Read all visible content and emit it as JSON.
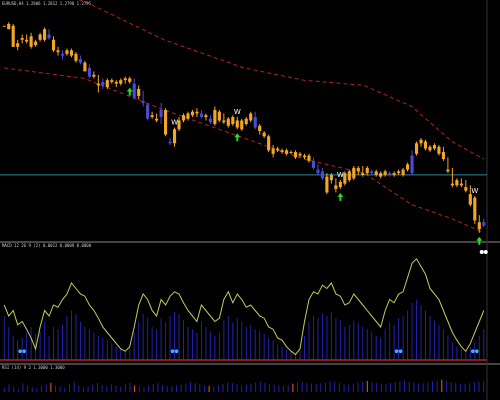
{
  "colors": {
    "background": "#000000",
    "bullish": "#f5a623",
    "bearish": "#4b4bd6",
    "bands": "#b22222",
    "signal_line": "#c8c85a",
    "histogram": "#2222aa",
    "level_line": "#2a8a9a",
    "up_arrow": "#22dd22",
    "dot_blue": "#3ab0ff",
    "dot_white": "#ffffff",
    "panel_border": "#8a8a8a"
  },
  "panels": {
    "price_header": "EURUSD,H4 1.2806 1.2812 1.2790 1.2795",
    "osc_header": "MACD 12 26 9 (2) 0.0012 0.0009 0.0000",
    "vol_header": "RSI (14)  9 2 1.3000 1.3000"
  },
  "chart_data": [
    {
      "type": "candlestick",
      "panel": "main",
      "series": [
        {
          "ohlc": [
            [
              96,
              96,
              96,
              96
            ],
            [
              94,
              98,
              95,
              97
            ],
            [
              84,
              97,
              84,
              96
            ],
            [
              84,
              88,
              82,
              86
            ],
            [
              88,
              91,
              86,
              89
            ],
            [
              87,
              91,
              86,
              88
            ],
            [
              84,
              92,
              83,
              90
            ],
            [
              85,
              88,
              84,
              87
            ],
            [
              88,
              92,
              87,
              91
            ],
            [
              88,
              95,
              87,
              94
            ],
            [
              91,
              94,
              88,
              89
            ],
            [
              82,
              90,
              81,
              88
            ],
            [
              81,
              84,
              79,
              82
            ],
            [
              80,
              82,
              77,
              79
            ],
            [
              80,
              83,
              79,
              82
            ],
            [
              79,
              83,
              78,
              82
            ],
            [
              76,
              81,
              75,
              80
            ],
            [
              77,
              79,
              74,
              75
            ],
            [
              70,
              76,
              70,
              75
            ],
            [
              72,
              74,
              66,
              67
            ],
            [
              67,
              70,
              66,
              68
            ],
            [
              62,
              68,
              58,
              63
            ],
            [
              64,
              66,
              60,
              62
            ],
            [
              61,
              66,
              60,
              65
            ],
            [
              64,
              66,
              63,
              65
            ],
            [
              63,
              65,
              61,
              64
            ],
            [
              63,
              66,
              62,
              65
            ],
            [
              65,
              67,
              63,
              66
            ],
            [
              64,
              67,
              63,
              66
            ],
            [
              63,
              66,
              54,
              55
            ],
            [
              56,
              62,
              54,
              60
            ],
            [
              53,
              59,
              50,
              52
            ],
            [
              51,
              52,
              42,
              43
            ],
            [
              44,
              47,
              43,
              45
            ],
            [
              42,
              46,
              41,
              43
            ],
            [
              48,
              52,
              40,
              44
            ],
            [
              34,
              49,
              33,
              48
            ],
            [
              30,
              32,
              28,
              29
            ],
            [
              29,
              38,
              27,
              37
            ],
            [
              37,
              44,
              36,
              42
            ],
            [
              42,
              46,
              41,
              45
            ],
            [
              43,
              47,
              42,
              46
            ],
            [
              45,
              48,
              44,
              47
            ],
            [
              46,
              49,
              44,
              47
            ],
            [
              46,
              48,
              43,
              44
            ],
            [
              44,
              46,
              42,
              45
            ],
            [
              43,
              45,
              40,
              41
            ],
            [
              40,
              50,
              39,
              48
            ],
            [
              42,
              48,
              41,
              47
            ],
            [
              41,
              46,
              40,
              42
            ],
            [
              39,
              44,
              38,
              43
            ],
            [
              40,
              45,
              39,
              44
            ],
            [
              38,
              44,
              37,
              42
            ],
            [
              37,
              43,
              36,
              42
            ],
            [
              40,
              44,
              39,
              43
            ],
            [
              42,
              47,
              41,
              46
            ],
            [
              44,
              47,
              37,
              38
            ],
            [
              36,
              40,
              34,
              39
            ],
            [
              33,
              36,
              32,
              35
            ],
            [
              25,
              34,
              24,
              33
            ],
            [
              23,
              28,
              21,
              26
            ],
            [
              25,
              27,
              24,
              26
            ],
            [
              24,
              26,
              23,
              25
            ],
            [
              23,
              26,
              22,
              25
            ],
            [
              24,
              25,
              23,
              24
            ],
            [
              21,
              25,
              20,
              24
            ],
            [
              22,
              24,
              21,
              23
            ],
            [
              21,
              23,
              20,
              22
            ],
            [
              19,
              23,
              18,
              22
            ],
            [
              19,
              21,
              14,
              15
            ],
            [
              14,
              17,
              11,
              12
            ],
            [
              13,
              15,
              8,
              9
            ],
            [
              1,
              12,
              0,
              10
            ],
            [
              8,
              12,
              6,
              11
            ],
            [
              3,
              9,
              1,
              5
            ],
            [
              4,
              8,
              3,
              7
            ],
            [
              6,
              13,
              5,
              12
            ],
            [
              8,
              14,
              7,
              13
            ],
            [
              9,
              16,
              8,
              15
            ],
            [
              13,
              16,
              11,
              15
            ],
            [
              11,
              16,
              10,
              12
            ],
            [
              12,
              16,
              11,
              15
            ],
            [
              13,
              14,
              11,
              12
            ],
            [
              11,
              14,
              10,
              13
            ],
            [
              10,
              13,
              9,
              12
            ],
            [
              11,
              14,
              10,
              13
            ],
            [
              12,
              13,
              10,
              11
            ],
            [
              11,
              13,
              10,
              12
            ],
            [
              12,
              14,
              11,
              13
            ],
            [
              11,
              15,
              10,
              14
            ],
            [
              14,
              18,
              13,
              17
            ],
            [
              22,
              25,
              11,
              12
            ],
            [
              23,
              30,
              22,
              29
            ],
            [
              29,
              32,
              27,
              31
            ],
            [
              26,
              31,
              25,
              30
            ],
            [
              25,
              28,
              24,
              27
            ],
            [
              26,
              29,
              25,
              28
            ],
            [
              23,
              28,
              22,
              27
            ],
            [
              20,
              27,
              19,
              24
            ],
            [
              13,
              21,
              12,
              14
            ],
            [
              5,
              15,
              4,
              6
            ],
            [
              5,
              9,
              4,
              8
            ],
            [
              5,
              9,
              4,
              6
            ],
            [
              2,
              8,
              1,
              4
            ],
            [
              -6,
              5,
              -7,
              0
            ],
            [
              -15,
              -1,
              -17,
              -2
            ],
            [
              -20,
              -12,
              -22,
              -16
            ],
            [
              -16,
              -14,
              -19,
              -18
            ]
          ]
        }
      ],
      "ylim": [
        -25,
        105
      ],
      "level": 11,
      "bands": {
        "upper": [
          [
            0,
            122
          ],
          [
            20,
            110
          ],
          [
            40,
            88
          ],
          [
            60,
            72
          ],
          [
            75,
            65
          ],
          [
            90,
            62
          ],
          [
            102,
            50
          ],
          [
            112,
            30
          ],
          [
            120,
            20
          ]
        ],
        "lower": [
          [
            0,
            72
          ],
          [
            20,
            66
          ],
          [
            40,
            48
          ],
          [
            60,
            32
          ],
          [
            75,
            20
          ],
          [
            90,
            12
          ],
          [
            102,
            -6
          ],
          [
            112,
            -14
          ],
          [
            120,
            -22
          ]
        ]
      },
      "markers": {
        "W": [
          38,
          52,
          75,
          105
        ],
        "up_arrows": [
          28,
          52,
          75,
          106
        ]
      }
    },
    {
      "type": "line",
      "panel": "oscillator",
      "ylim": [
        0,
        100
      ],
      "signal": [
        50,
        40,
        45,
        32,
        35,
        28,
        20,
        10,
        30,
        45,
        40,
        50,
        48,
        55,
        60,
        70,
        65,
        60,
        58,
        50,
        45,
        38,
        30,
        25,
        20,
        15,
        10,
        8,
        12,
        30,
        50,
        60,
        55,
        45,
        40,
        55,
        50,
        58,
        62,
        60,
        52,
        45,
        40,
        35,
        50,
        45,
        40,
        35,
        38,
        55,
        62,
        52,
        60,
        55,
        48,
        50,
        45,
        40,
        38,
        30,
        28,
        20,
        18,
        12,
        8,
        5,
        10,
        35,
        55,
        62,
        60,
        68,
        65,
        70,
        60,
        58,
        50,
        52,
        60,
        55,
        50,
        45,
        40,
        35,
        30,
        45,
        55,
        52,
        60,
        62,
        75,
        88,
        92,
        85,
        78,
        65,
        60,
        55,
        45,
        35,
        25,
        18,
        12,
        8,
        15,
        25,
        35,
        45
      ],
      "histogram": [
        40,
        30,
        22,
        18,
        20,
        25,
        30,
        24,
        26,
        35,
        22,
        30,
        28,
        32,
        40,
        45,
        42,
        35,
        30,
        28,
        25,
        22,
        20,
        18,
        15,
        12,
        10,
        8,
        14,
        25,
        35,
        42,
        38,
        30,
        28,
        38,
        34,
        40,
        44,
        42,
        36,
        30,
        28,
        25,
        35,
        30,
        26,
        22,
        25,
        36,
        40,
        34,
        38,
        35,
        30,
        32,
        28,
        26,
        24,
        20,
        18,
        14,
        12,
        10,
        8,
        6,
        8,
        22,
        35,
        40,
        38,
        42,
        40,
        44,
        38,
        36,
        30,
        32,
        36,
        34,
        30,
        28,
        26,
        22,
        20,
        28,
        34,
        32,
        38,
        40,
        45,
        52,
        55,
        50,
        45,
        40,
        36,
        32,
        28,
        22,
        16,
        12,
        10,
        8,
        12,
        16,
        22,
        28
      ],
      "blue_dots": [
        4,
        38,
        88,
        105
      ],
      "white_dots": [
        110
      ]
    },
    {
      "type": "bar",
      "panel": "lower",
      "ylim": [
        0,
        100
      ],
      "values": [
        20,
        35,
        25,
        15,
        40,
        30,
        22,
        18,
        28,
        35,
        42,
        30,
        25,
        20,
        38,
        45,
        30,
        22,
        26,
        34,
        40,
        32,
        28,
        35,
        30,
        25,
        38,
        42,
        30,
        26,
        22,
        30,
        36,
        40,
        32,
        28,
        26,
        30,
        34,
        38,
        45,
        40,
        36,
        30,
        28,
        26,
        32,
        38,
        44,
        40,
        36,
        30,
        34,
        38,
        42,
        46,
        40,
        36,
        34,
        30,
        28,
        32,
        38,
        44,
        48,
        42,
        38,
        36,
        40,
        44,
        50,
        46,
        40,
        36,
        34,
        38,
        42,
        46,
        50,
        44,
        40,
        38,
        36,
        40,
        44,
        48,
        52,
        46,
        42,
        38,
        40,
        44,
        48,
        52,
        56,
        50,
        46,
        42,
        38,
        36,
        40,
        44,
        48,
        52
      ],
      "highlights": [
        10,
        28,
        44,
        62,
        78,
        94
      ]
    }
  ]
}
